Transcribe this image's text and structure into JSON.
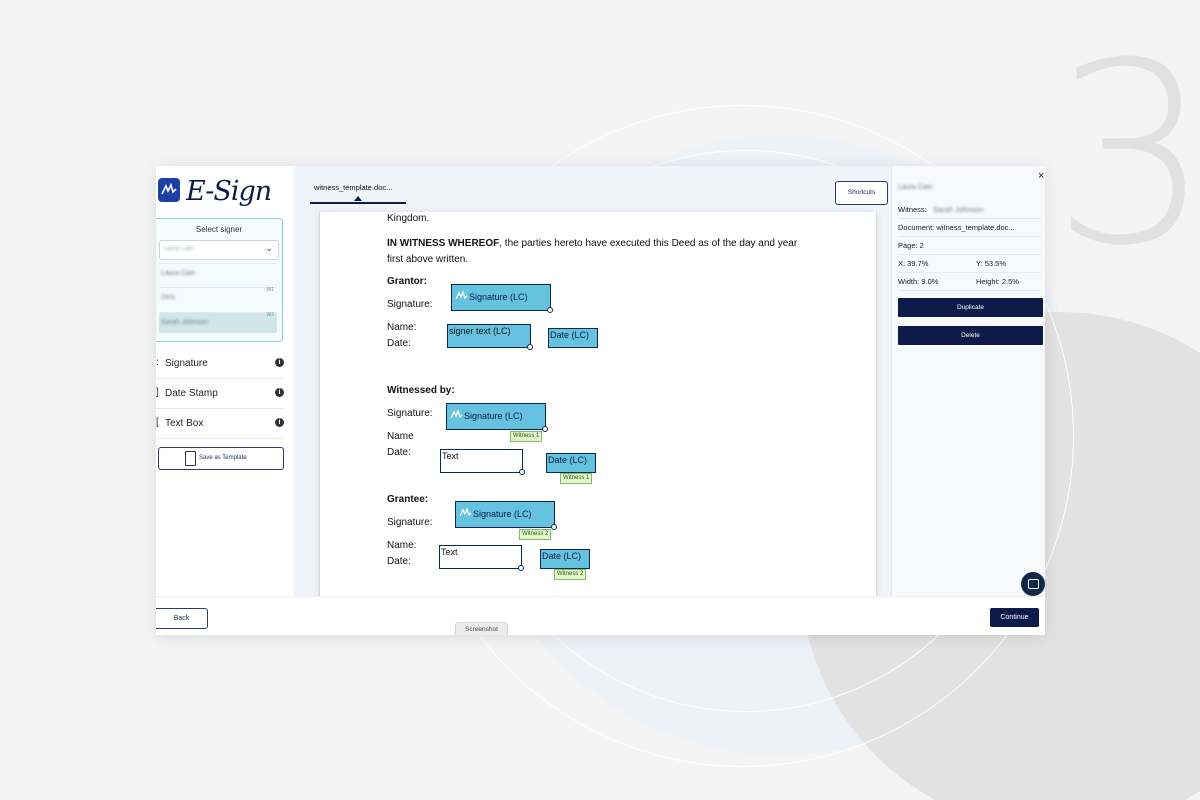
{
  "brand": {
    "logo_text": "E-Sign",
    "logo_color": "#1e3fa8",
    "primary_color": "#0d1b4b",
    "field_color": "#66c3df"
  },
  "background": {
    "step_number": "3"
  },
  "signer_panel": {
    "title": "Select signer",
    "selected_value": "Laura Cain",
    "options": [
      {
        "name": "Laura Cain",
        "tag": ""
      },
      {
        "name": "Desi",
        "tag": "W1"
      },
      {
        "name": "Sarah Johnson",
        "tag": "W2"
      }
    ]
  },
  "tools": [
    {
      "label": "Signature",
      "icon": "signature-icon"
    },
    {
      "label": "Date Stamp",
      "icon": "date-stamp-icon"
    },
    {
      "label": "Text Box",
      "icon": "text-box-icon"
    }
  ],
  "save_template": {
    "label": "Save as Template",
    "icon": "document-icon"
  },
  "tabs": [
    {
      "label": "witness_template.doc..."
    }
  ],
  "shortcuts_label": "Shortcuts",
  "document": {
    "line_kingdom": "Kingdom.",
    "witness_para_bold": "IN WITNESS WHEREOF",
    "witness_para_rest": ", the parties hereto have executed this Deed as of the day and year first above written.",
    "grantor_heading": "Grantor:",
    "signature_label": "Signature:",
    "name_label_colon": "Name:",
    "name_label": "Name",
    "date_label": "Date:",
    "witnessed_heading": "Witnessed by:",
    "grantee_heading": "Grantee:",
    "fields": {
      "signature": "Signature (LC)",
      "signer_text": "signer text (LC)",
      "date": "Date (LC)",
      "text": "Text",
      "witness1": "Witness 1",
      "witness2": "Witness 2"
    }
  },
  "properties": {
    "signer_name": "Laura Cain",
    "witness_label": "Witness:",
    "witness_value": "Sarah Johnson",
    "document": "Document: witness_template.doc...",
    "page": "Page: 2",
    "x": "X: 39.7%",
    "y": "Y: 53.5%",
    "width": "Width: 9.0%",
    "height": "Height: 2.5%",
    "duplicate_label": "Duplicate",
    "delete_label": "Delete"
  },
  "footer": {
    "back_label": "Back",
    "continue_label": "Continue",
    "screenshot_label": "Screenshot"
  }
}
